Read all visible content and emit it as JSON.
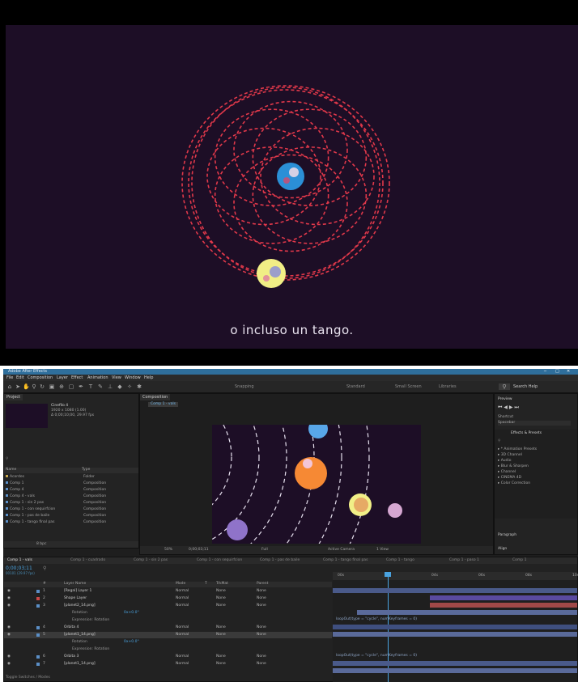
{
  "video": {
    "subtitle": "o incluso un tango."
  },
  "app": {
    "title": "Adobe After Effects",
    "menu": [
      "File",
      "Edit",
      "Composition",
      "Layer",
      "Effect",
      "Animation",
      "View",
      "Window",
      "Help"
    ],
    "toolbar": {
      "snapping": "Snapping",
      "workspaces": [
        "Standard",
        "Small Screen",
        "Libraries"
      ],
      "search": "Search Help"
    }
  },
  "project_panel": {
    "tab": "Project",
    "selected": {
      "name": "Cinefilo 4",
      "info1": "1920 x 1080 (1.00)",
      "info2": "Δ 0;00;10;00, 29.97 fps"
    },
    "columns": [
      "Name",
      "Type"
    ],
    "items": [
      {
        "name": "Acordes",
        "type": "Folder"
      },
      {
        "name": "Comp 1",
        "type": "Composition"
      },
      {
        "name": "Comp 4",
        "type": "Composition"
      },
      {
        "name": "Comp 4 - vals",
        "type": "Composition"
      },
      {
        "name": "Comp 1 - sin 2 pas",
        "type": "Composition"
      },
      {
        "name": "Comp 1 - con sequirfcion",
        "type": "Composition"
      },
      {
        "name": "Comp 1 - pas de baile",
        "type": "Composition"
      },
      {
        "name": "Comp 1 - tango final pas",
        "type": "Composition"
      }
    ],
    "footer": "8 bpc"
  },
  "comp_panel": {
    "tab": "Composition",
    "comp_name": "Comp 1 - vals",
    "footer": {
      "zoom": "50%",
      "time": "0;00;03;11",
      "quality": "Full",
      "camera": "Active Camera",
      "views": "1 View"
    }
  },
  "right_panels": {
    "preview": "Preview",
    "shortcut_label": "Shortcut",
    "shortcut_value": "Spacebar",
    "effects_tab": "Effects & Presets",
    "effects": [
      "* Animation Presets",
      "3D Channel",
      "Audio",
      "Blur & Sharpen",
      "Channel",
      "CINEMA 4D",
      "Color Correction"
    ],
    "paragraph": "Paragraph",
    "align": "Align"
  },
  "timeline": {
    "tabs": [
      "Comp 1 - vals",
      "Comp 1 - cuadrado",
      "Comp 1 - sin 2 pas",
      "Comp 1 - con sequirfcion",
      "Comp 1 - pas de baile",
      "Comp 1 - tango final pas",
      "Comp 1 - tango",
      "Comp 1 - paso 1",
      "Comp 1"
    ],
    "timecode": "0;00;03;11",
    "frame": "00101 (29.97 fps)",
    "headers": [
      "#",
      "Layer Name",
      "Mode",
      "T",
      "TrkMat",
      "Parent"
    ],
    "ruler": [
      "00s",
      "02s",
      "04s",
      "06s",
      "08s",
      "10s"
    ],
    "rows": [
      {
        "num": "1",
        "name": "[Regal] Layer 1",
        "mode": "Normal",
        "trkmat": "None",
        "parent": "None"
      },
      {
        "num": "2",
        "name": "Shape Layer",
        "mode": "Normal",
        "trkmat": "None",
        "parent": "None"
      },
      {
        "num": "3",
        "name": "[planet2_14.png]",
        "mode": "Normal",
        "trkmat": "None",
        "parent": "None"
      },
      {
        "num": "",
        "name": "Rotation",
        "mode": "",
        "trkmat": "",
        "parent": "",
        "value": "0x+0.0°"
      },
      {
        "num": "",
        "name": "Expression: Rotation",
        "mode": "",
        "trkmat": "",
        "parent": ""
      },
      {
        "num": "4",
        "name": "Orbita 4",
        "mode": "Normal",
        "trkmat": "None",
        "parent": "None"
      },
      {
        "num": "5",
        "name": "[planet1_14.png]",
        "mode": "Normal",
        "trkmat": "None",
        "parent": "None"
      },
      {
        "num": "",
        "name": "Rotation",
        "mode": "",
        "trkmat": "",
        "parent": "",
        "value": "0x+0.0°"
      },
      {
        "num": "",
        "name": "Expression: Rotation",
        "mode": "",
        "trkmat": "",
        "parent": ""
      },
      {
        "num": "6",
        "name": "Orbita 3",
        "mode": "Normal",
        "trkmat": "None",
        "parent": "None"
      },
      {
        "num": "7",
        "name": "[planet1_14.png]",
        "mode": "Normal",
        "trkmat": "None",
        "parent": "None"
      }
    ],
    "expression": "loopOut(type = \"cycle\", numKeyframes = 0)",
    "footer": "Toggle Switches / Modes"
  },
  "colors": {
    "video_bg": "#1d0e26",
    "orbit": "#e0384a",
    "accent": "#2f8fcf"
  }
}
